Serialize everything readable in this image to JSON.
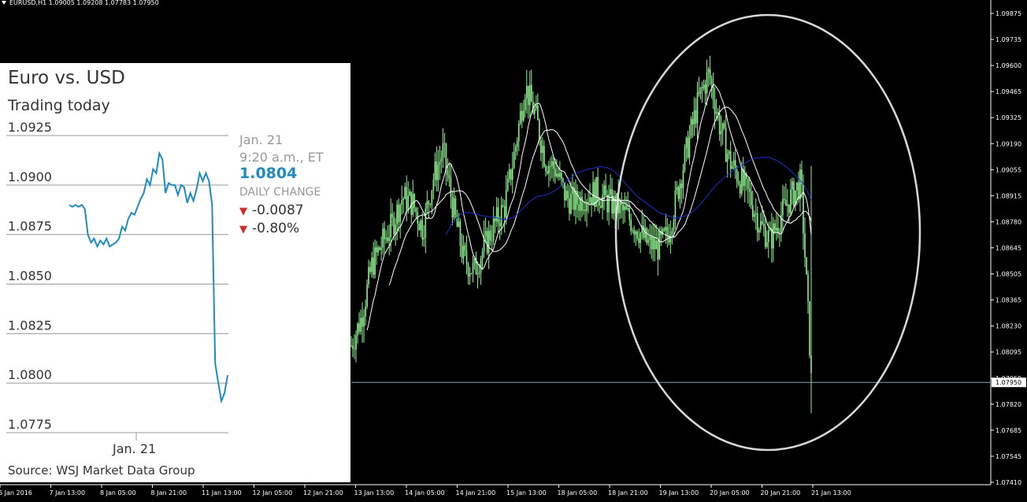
{
  "terminal": {
    "symbol_header": "EURUSD,H1  1.09005 1.09208 1.07783 1.07950",
    "current_price_tag": "1.07950",
    "colors": {
      "background": "#000000",
      "candles": "#8ef08e",
      "ma_fast": "#ffffff",
      "ma_slow": "#1b2fd0",
      "highlight_ellipse": "#d8d8d8",
      "price_line": "#8aa4b0"
    }
  },
  "chart_data": [
    {
      "type": "candlestick",
      "series_name": "EURUSD,H1",
      "y_axis_labels": [
        "1.09875",
        "1.09735",
        "1.09600",
        "1.09465",
        "1.09325",
        "1.09190",
        "1.09055",
        "1.08915",
        "1.08780",
        "1.08645",
        "1.08505",
        "1.08365",
        "1.08230",
        "1.08095",
        "1.07950",
        "1.07820",
        "1.07685",
        "1.07545",
        "1.07410"
      ],
      "x_axis_labels": [
        "6 Jan 2016",
        "7 Jan 13:00",
        "8 Jan 05:00",
        "8 Jan 21:00",
        "11 Jan 13:00",
        "12 Jan 05:00",
        "12 Jan 21:00",
        "13 Jan 13:00",
        "14 Jan 05:00",
        "14 Jan 21:00",
        "15 Jan 13:00",
        "18 Jan 05:00",
        "18 Jan 21:00",
        "19 Jan 13:00",
        "20 Jan 05:00",
        "20 Jan 21:00",
        "21 Jan 13:00"
      ],
      "ylim": [
        1.0741,
        1.0994
      ],
      "close_path": [
        1.0815,
        1.083,
        1.0858,
        1.087,
        1.088,
        1.0895,
        1.0892,
        1.0878,
        1.0905,
        1.092,
        1.0888,
        1.0862,
        1.0855,
        1.0868,
        1.088,
        1.089,
        1.092,
        1.0955,
        1.094,
        1.0915,
        1.091,
        1.0895,
        1.0892,
        1.0896,
        1.0898,
        1.0893,
        1.089,
        1.0885,
        1.0878,
        1.087,
        1.0868,
        1.0875,
        1.09,
        1.0925,
        1.0948,
        1.0962,
        1.0935,
        1.0915,
        1.0905,
        1.0895,
        1.088,
        1.0872,
        1.0885,
        1.0895,
        1.0903,
        1.08
      ]
    },
    {
      "type": "line",
      "title": "Euro vs. USD",
      "subtitle": "Trading today",
      "y_ticks": [
        "1.0925",
        "1.0900",
        "1.0875",
        "1.0850",
        "1.0825",
        "1.0800",
        "1.0775"
      ],
      "ylim": [
        1.0775,
        1.0925
      ],
      "x_label": "Jan. 21",
      "values": [
        1.089,
        1.0889,
        1.089,
        1.0889,
        1.089,
        1.0888,
        1.0875,
        1.0871,
        1.0873,
        1.0869,
        1.0872,
        1.087,
        1.0873,
        1.0869,
        1.087,
        1.0871,
        1.0873,
        1.0879,
        1.0877,
        1.0883,
        1.0886,
        1.0885,
        1.0889,
        1.0893,
        1.0896,
        1.0903,
        1.09,
        1.0908,
        1.0906,
        1.0916,
        1.0913,
        1.0896,
        1.0901,
        1.09,
        1.09,
        1.0895,
        1.09,
        1.0899,
        1.0891,
        1.0896,
        1.0892,
        1.0898,
        1.0906,
        1.0902,
        1.0906,
        1.0902,
        1.089,
        1.081,
        1.08,
        1.0791,
        1.0795,
        1.0804
      ]
    }
  ],
  "wsj_box": {
    "title": "Euro vs. USD",
    "subtitle": "Trading today",
    "date": "Jan. 21",
    "time": "9:20 a.m., ET",
    "price": "1.0804",
    "daily_change_label": "DAILY CHANGE",
    "change_abs": "-0.0087",
    "change_pct": "-0.80%",
    "x_label": "Jan. 21",
    "source": "Source: WSJ Market Data Group",
    "colors": {
      "line": "#1f8bc0",
      "grid": "#9a9a9a",
      "down": "#d42a2a"
    }
  }
}
